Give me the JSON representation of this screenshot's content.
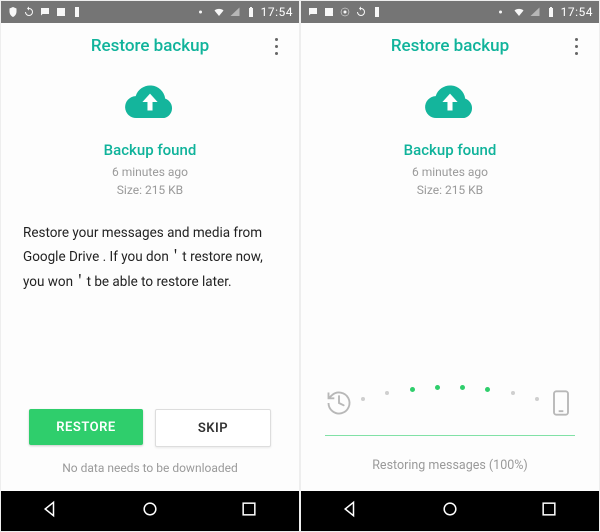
{
  "status": {
    "clock": "17:54"
  },
  "header": {
    "title": "Restore backup"
  },
  "backup": {
    "found_title": "Backup found",
    "time": "6 minutes ago",
    "size": "Size: 215 KB"
  },
  "left": {
    "body": "Restore your messages and media from Google Drive . If you don＇t restore now, you won＇t be able to restore later.",
    "restore_label": "RESTORE",
    "skip_label": "SKIP",
    "footer": "No data needs to be downloaded"
  },
  "right": {
    "progress_text": "Restoring messages (100%)"
  }
}
